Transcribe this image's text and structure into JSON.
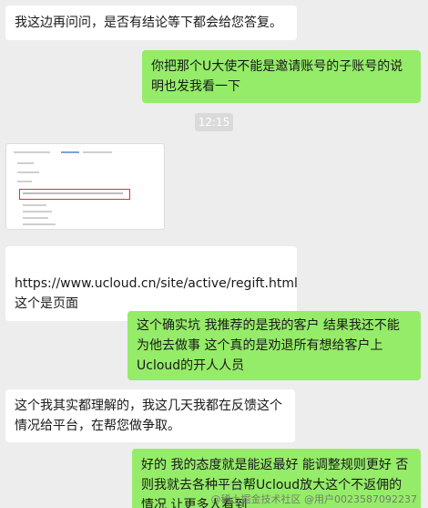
{
  "messages": [
    {
      "side": "left",
      "text": "我这边再问问，是否有结论等下都会给您答复。"
    },
    {
      "side": "right",
      "text": "你把那个U大使不能是邀请账号的子账号的说明也发我看一下"
    },
    {
      "side": "left",
      "text": "https://www.ucloud.cn/site/active/regift.html\n这个是页面"
    },
    {
      "side": "right",
      "text": "这个确实坑 我推荐的是我的客户 结果我还不能为他去做事 这个真的是劝退所有想给客户上Ucloud的开人人员"
    },
    {
      "side": "left",
      "text": "这个我其实都理解的，我这几天我都在反馈这个情况给平台，在帮您做争取。"
    },
    {
      "side": "right",
      "text": "好的 我的态度就是能返最好 能调整规则更好 否则我就去各种平台帮Ucloud放大这个不返佣的情况 让更多人看到"
    }
  ],
  "timestamp": "12:15",
  "image_message": {
    "kind": "screenshot-thumbnail"
  },
  "watermark": "@稀土掘金技术社区 @用户0023587092237"
}
